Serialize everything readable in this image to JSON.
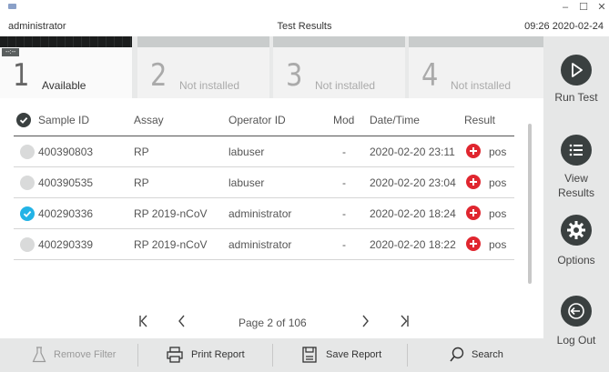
{
  "window": {
    "user": "administrator",
    "title": "Test Results",
    "datetime": "09:26 2020-02-24",
    "minimize_glyph": "–",
    "maximize_glyph": "☐",
    "close_glyph": "✕"
  },
  "modules": [
    {
      "number": "1",
      "label": "Available",
      "badge": "--:--",
      "active": true
    },
    {
      "number": "2",
      "label": "Not installed",
      "active": false
    },
    {
      "number": "3",
      "label": "Not installed",
      "active": false
    },
    {
      "number": "4",
      "label": "Not installed",
      "active": false
    }
  ],
  "table": {
    "headers": {
      "sample_id": "Sample ID",
      "assay": "Assay",
      "operator_id": "Operator ID",
      "mod": "Mod",
      "datetime": "Date/Time",
      "result": "Result"
    },
    "rows": [
      {
        "sample_id": "400390803",
        "assay": "RP",
        "operator": "labuser",
        "mod": "-",
        "datetime": "2020-02-20 23:11",
        "result": "pos",
        "selected": false
      },
      {
        "sample_id": "400390535",
        "assay": "RP",
        "operator": "labuser",
        "mod": "-",
        "datetime": "2020-02-20 23:04",
        "result": "pos",
        "selected": false
      },
      {
        "sample_id": "400290336",
        "assay": "RP 2019-nCoV",
        "operator": "administrator",
        "mod": "-",
        "datetime": "2020-02-20 18:24",
        "result": "pos",
        "selected": true
      },
      {
        "sample_id": "400290339",
        "assay": "RP 2019-nCoV",
        "operator": "administrator",
        "mod": "-",
        "datetime": "2020-02-20 18:22",
        "result": "pos",
        "selected": false
      }
    ]
  },
  "pager": {
    "text": "Page 2 of 106",
    "first_glyph": "K",
    "prev_glyph": "<",
    "next_glyph": ">",
    "last_glyph": "K"
  },
  "toolbar": {
    "remove_filter": "Remove Filter",
    "print_report": "Print Report",
    "save_report": "Save Report",
    "search": "Search"
  },
  "sidebar": {
    "run_test": "Run Test",
    "view_results_1": "View",
    "view_results_2": "Results",
    "options": "Options",
    "log_out": "Log Out"
  },
  "colors": {
    "accent": "#23b3e6",
    "positive": "#e0262f",
    "sidebar_bg": "#e6e7e7",
    "icon_dark": "#3a4040"
  },
  "icons": {
    "select_all": "check-circle-icon",
    "result_pos": "plus-circle-icon",
    "filter": "flask-icon",
    "print": "printer-icon",
    "save": "save-document-icon",
    "search": "magnifier-icon",
    "run_test": "play-icon",
    "view_results": "list-icon",
    "options": "gear-icon",
    "log_out": "logout-arrow-icon"
  }
}
